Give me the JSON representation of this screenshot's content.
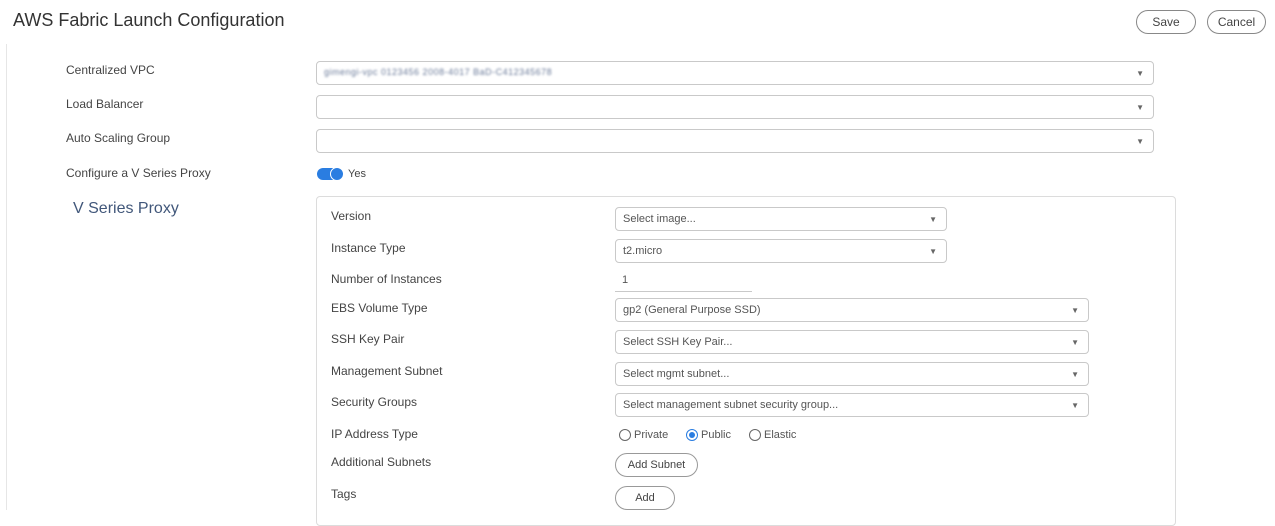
{
  "header": {
    "title": "AWS Fabric Launch Configuration",
    "save_label": "Save",
    "cancel_label": "Cancel"
  },
  "form": {
    "centralized_vpc": {
      "label": "Centralized VPC",
      "value": "gimengi-vpc 0123456 2008-4017 BaD-C412345678"
    },
    "load_balancer": {
      "label": "Load Balancer",
      "value": ""
    },
    "auto_scaling_group": {
      "label": "Auto Scaling Group",
      "value": ""
    },
    "configure_proxy": {
      "label": "Configure a V Series Proxy",
      "value_label": "Yes",
      "enabled": true
    }
  },
  "proxy": {
    "section_title": "V Series Proxy",
    "version": {
      "label": "Version",
      "placeholder": "Select image..."
    },
    "instance_type": {
      "label": "Instance Type",
      "value": "t2.micro"
    },
    "number_of_instances": {
      "label": "Number of Instances",
      "value": "1"
    },
    "ebs_volume_type": {
      "label": "EBS Volume Type",
      "value": "gp2 (General Purpose SSD)"
    },
    "ssh_key_pair": {
      "label": "SSH Key Pair",
      "placeholder": "Select SSH Key Pair..."
    },
    "management_subnet": {
      "label": "Management Subnet",
      "placeholder": "Select mgmt subnet..."
    },
    "security_groups": {
      "label": "Security Groups",
      "placeholder": "Select management subnet security group..."
    },
    "ip_address_type": {
      "label": "IP Address Type",
      "options": [
        "Private",
        "Public",
        "Elastic"
      ],
      "selected": "Public"
    },
    "additional_subnets": {
      "label": "Additional Subnets",
      "button_label": "Add Subnet"
    },
    "tags": {
      "label": "Tags",
      "button_label": "Add"
    }
  },
  "colors": {
    "accent": "#2a7de1",
    "section_title": "#41577a"
  },
  "icons": {
    "caret": "caret-down-icon",
    "radio": "radio-icon"
  }
}
